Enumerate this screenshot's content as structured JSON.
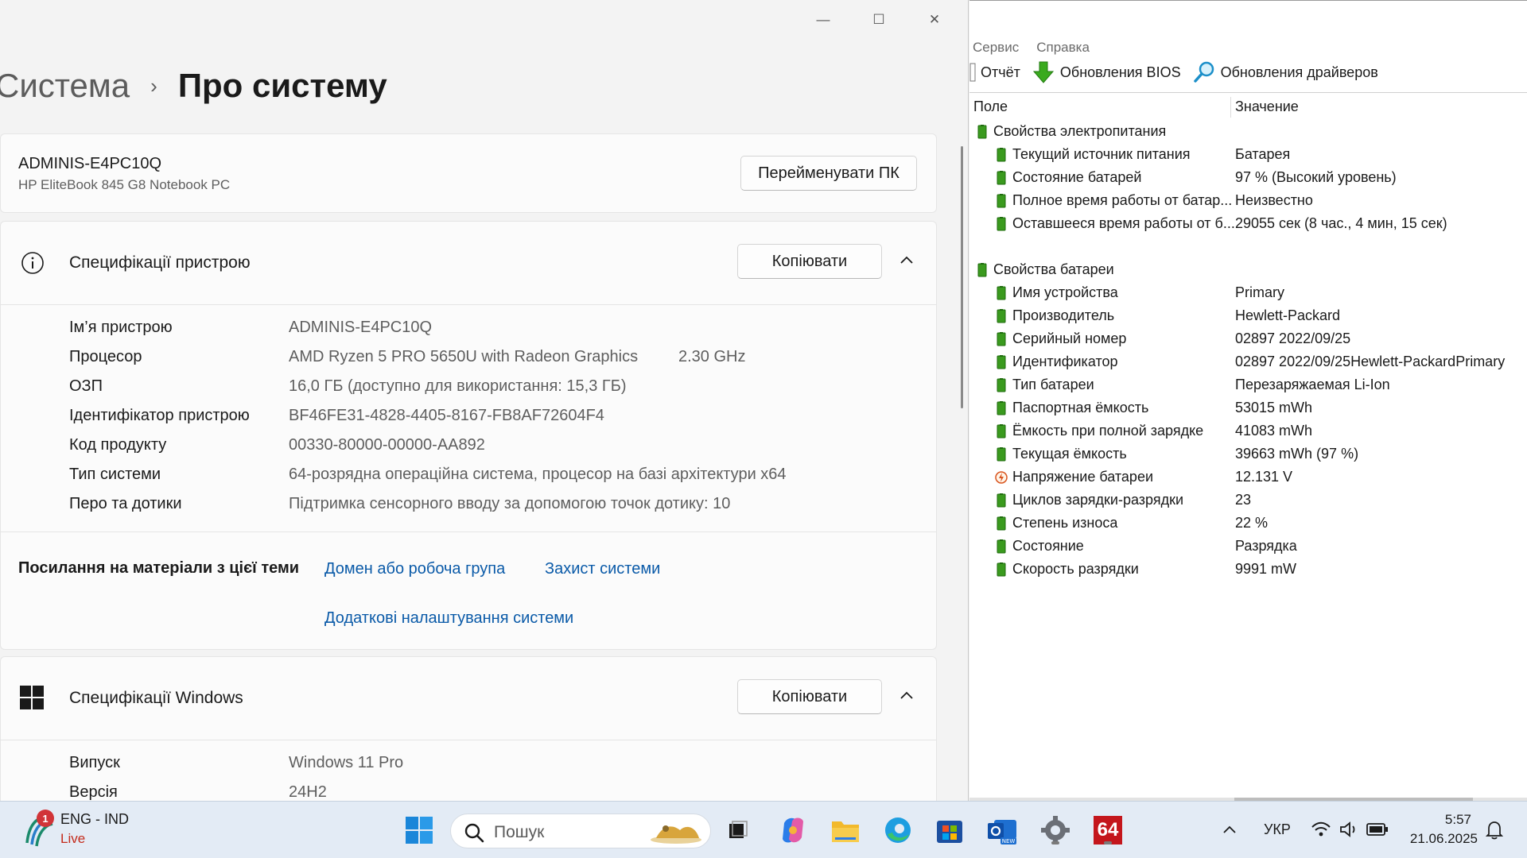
{
  "settings": {
    "window_controls": {
      "minimize": "—",
      "maximize": "☐",
      "close": "✕"
    },
    "breadcrumb": {
      "parent": "Система",
      "separator": "›",
      "current": "Про систему"
    },
    "pc": {
      "name": "ADMINIS-E4PC10Q",
      "model": "HP EliteBook 845 G8 Notebook PC",
      "rename_label": "Перейменувати ПК"
    },
    "device_specs": {
      "title": "Специфікації пристрою",
      "copy_label": "Копіювати",
      "rows": [
        {
          "label": "Ім’я пристрою",
          "value": "ADMINIS-E4PC10Q",
          "extra": ""
        },
        {
          "label": "Процесор",
          "value": "AMD Ryzen 5 PRO 5650U with Radeon Graphics",
          "extra": "2.30 GHz"
        },
        {
          "label": "ОЗП",
          "value": "16,0 ГБ (доступно для використання: 15,3 ГБ)",
          "extra": ""
        },
        {
          "label": "Ідентифікатор пристрою",
          "value": "BF46FE31-4828-4405-8167-FB8AF72604F4",
          "extra": ""
        },
        {
          "label": "Код продукту",
          "value": "00330-80000-00000-AA892",
          "extra": ""
        },
        {
          "label": "Тип системи",
          "value": "64-розрядна операційна система, процесор на базі архітектури x64",
          "extra": ""
        },
        {
          "label": "Перо та дотики",
          "value": "Підтримка сенсорного вводу за допомогою точок дотику: 10",
          "extra": ""
        }
      ]
    },
    "related_links": {
      "label": "Посилання на матеріали з цієї теми",
      "links": [
        "Домен або робоча група",
        "Захист системи",
        "Додаткові налаштування системи"
      ]
    },
    "windows_specs": {
      "title": "Специфікації Windows",
      "copy_label": "Копіювати",
      "rows": [
        {
          "label": "Випуск",
          "value": "Windows 11 Pro"
        },
        {
          "label": "Версія",
          "value": "24H2"
        }
      ]
    }
  },
  "aida": {
    "menu": [
      "Сервис",
      "Справка"
    ],
    "toolbar": [
      "Отчёт",
      "Обновления BIOS",
      "Обновления драйверов"
    ],
    "columns": {
      "field": "Поле",
      "value": "Значение"
    },
    "groups": [
      {
        "title": "Свойства электропитания",
        "items": [
          {
            "field": "Текущий источник питания",
            "value": "Батарея",
            "icon": "battery-icon"
          },
          {
            "field": "Состояние батарей",
            "value": "97 % (Высокий уровень)",
            "icon": "battery-icon"
          },
          {
            "field": "Полное время работы от батар...",
            "value": "Неизвестно",
            "icon": "battery-icon"
          },
          {
            "field": "Оставшееся время работы от б...",
            "value": "29055 сек (8 час., 4 мин, 15 сек)",
            "icon": "battery-icon"
          }
        ]
      },
      {
        "title": "Свойства батареи",
        "items": [
          {
            "field": "Имя устройства",
            "value": "Primary",
            "icon": "battery-icon"
          },
          {
            "field": "Производитель",
            "value": "Hewlett-Packard",
            "icon": "battery-icon"
          },
          {
            "field": "Серийный номер",
            "value": "02897 2022/09/25",
            "icon": "battery-icon"
          },
          {
            "field": "Идентификатор",
            "value": "02897 2022/09/25Hewlett-PackardPrimary",
            "icon": "battery-icon"
          },
          {
            "field": "Тип батареи",
            "value": "Перезаряжаемая Li-Ion",
            "icon": "battery-icon"
          },
          {
            "field": "Паспортная ёмкость",
            "value": "53015 mWh",
            "icon": "battery-icon"
          },
          {
            "field": "Ёмкость при полной зарядке",
            "value": "41083 mWh",
            "icon": "battery-icon"
          },
          {
            "field": "Текущая ёмкость",
            "value": "39663 mWh  (97 %)",
            "icon": "battery-icon"
          },
          {
            "field": "Напряжение батареи",
            "value": "12.131 V",
            "icon": "voltage-icon"
          },
          {
            "field": "Циклов зарядки-разрядки",
            "value": "23",
            "icon": "battery-icon"
          },
          {
            "field": "Степень износа",
            "value": "22 %",
            "icon": "battery-icon"
          },
          {
            "field": "Состояние",
            "value": "Разрядка",
            "icon": "battery-icon"
          },
          {
            "field": "Скорость разрядки",
            "value": "9991 mW",
            "icon": "battery-icon"
          }
        ]
      }
    ]
  },
  "taskbar": {
    "weather_badge": "1",
    "lang": "ENG - IND",
    "live": "Live",
    "search_placeholder": "Пошук",
    "aida_label": "64",
    "tray_lang": "УКР",
    "time": "5:57",
    "date": "21.06.2025"
  },
  "colors": {
    "accent_link": "#0a5aa8",
    "live_red": "#c42b1c",
    "battery_green": "#3a9a1e",
    "taskbar_bg": "#e3ebf5"
  }
}
